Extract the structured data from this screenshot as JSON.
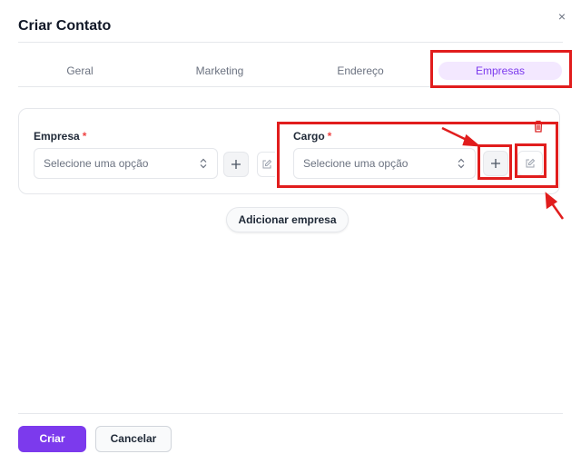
{
  "modal": {
    "title": "Criar Contato",
    "close_label": "×"
  },
  "tabs": [
    {
      "label": "Geral",
      "active": false
    },
    {
      "label": "Marketing",
      "active": false
    },
    {
      "label": "Endereço",
      "active": false
    },
    {
      "label": "Empresas",
      "active": true
    }
  ],
  "company_block": {
    "empresa": {
      "label": "Empresa",
      "required_mark": "*",
      "placeholder": "Selecione uma opção"
    },
    "cargo": {
      "label": "Cargo",
      "required_mark": "*",
      "placeholder": "Selecione uma opção"
    }
  },
  "add_company_label": "Adicionar empresa",
  "footer": {
    "create_label": "Criar",
    "cancel_label": "Cancelar"
  },
  "icons": {
    "close": "close-icon",
    "select_arrows": "chevron-updown-icon",
    "add": "plus-icon",
    "edit": "pencil-square-icon",
    "delete": "trash-icon"
  },
  "colors": {
    "accent": "#7c3aed",
    "active_tab_bg": "#f3e8ff",
    "required": "#ef4444",
    "delete": "#dc2626",
    "annotation": "#e11d1d"
  }
}
